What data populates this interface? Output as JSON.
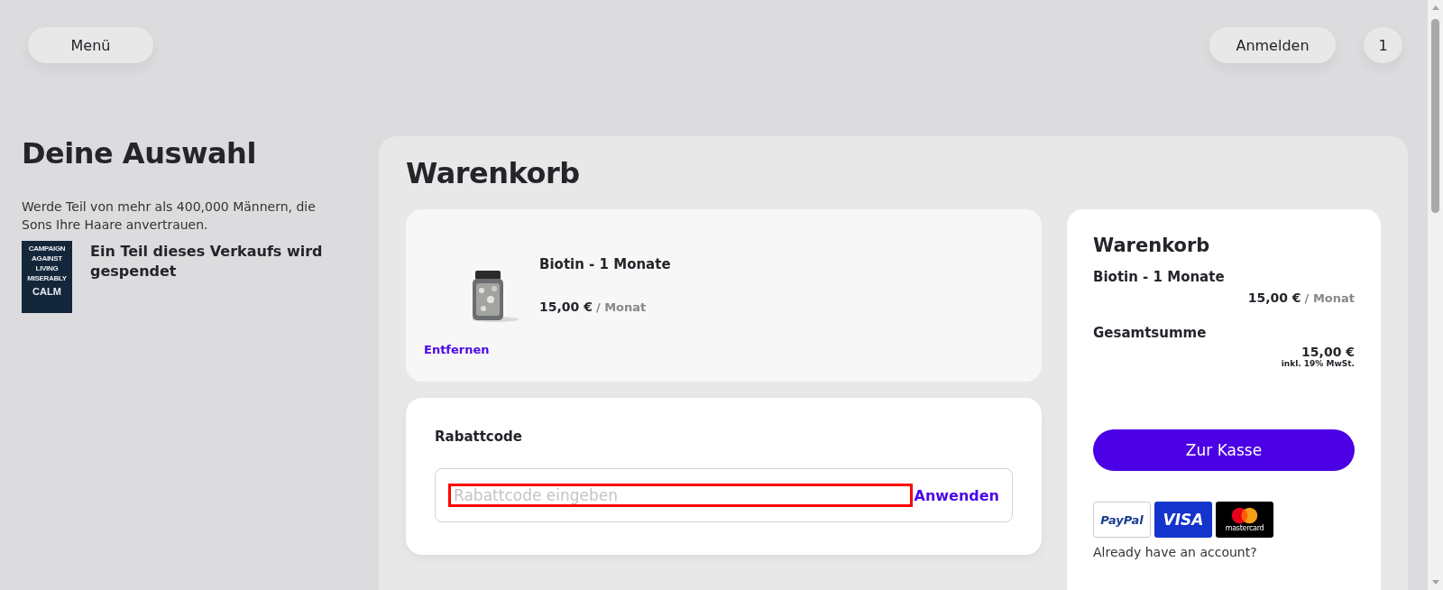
{
  "header": {
    "menu_button": "Menü",
    "login_button": "Anmelden",
    "cart_count": "1"
  },
  "intro": {
    "title": "Deine Auswahl",
    "text": "Werde Teil von mehr als 400,000 Männern, die Sons Ihre Haare anvertrauen.",
    "charity_logo_lines": [
      "CAMPAIGN",
      "AGAINST",
      "LIVING",
      "MISERABLY"
    ],
    "charity_logo_name": "CALM",
    "charity_text": "Ein Teil dieses Verkaufs wird gespendet"
  },
  "cart": {
    "title": "Warenkorb",
    "items": [
      {
        "kind": "picture",
        "name": "Biotin - 1 Monate",
        "price": "15,00 €",
        "period": "/ Monat",
        "remove_link": "Entfernen"
      }
    ],
    "discount": {
      "label": "Rabattcode",
      "placeholder": "Rabattcode eingeben",
      "focused": true,
      "apply_button": "Anwenden"
    }
  },
  "summary": {
    "title": "Warenkorb",
    "items": [
      {
        "name": "Biotin - 1 Monate",
        "price": "15,00 €",
        "period": "/ Monat"
      }
    ],
    "total_label": "Gesamtsumme",
    "total": "15,00 €",
    "tax_note": "inkl. 19% MwSt.",
    "checkout_button": "Zur Kasse",
    "payment_methods": [
      {
        "kind": "paypal",
        "label": "PayPal"
      },
      {
        "kind": "visa",
        "label": "VISA"
      },
      {
        "kind": "mastercard",
        "label": "mastercard"
      }
    ],
    "account_prompt": "Already have an account?"
  }
}
